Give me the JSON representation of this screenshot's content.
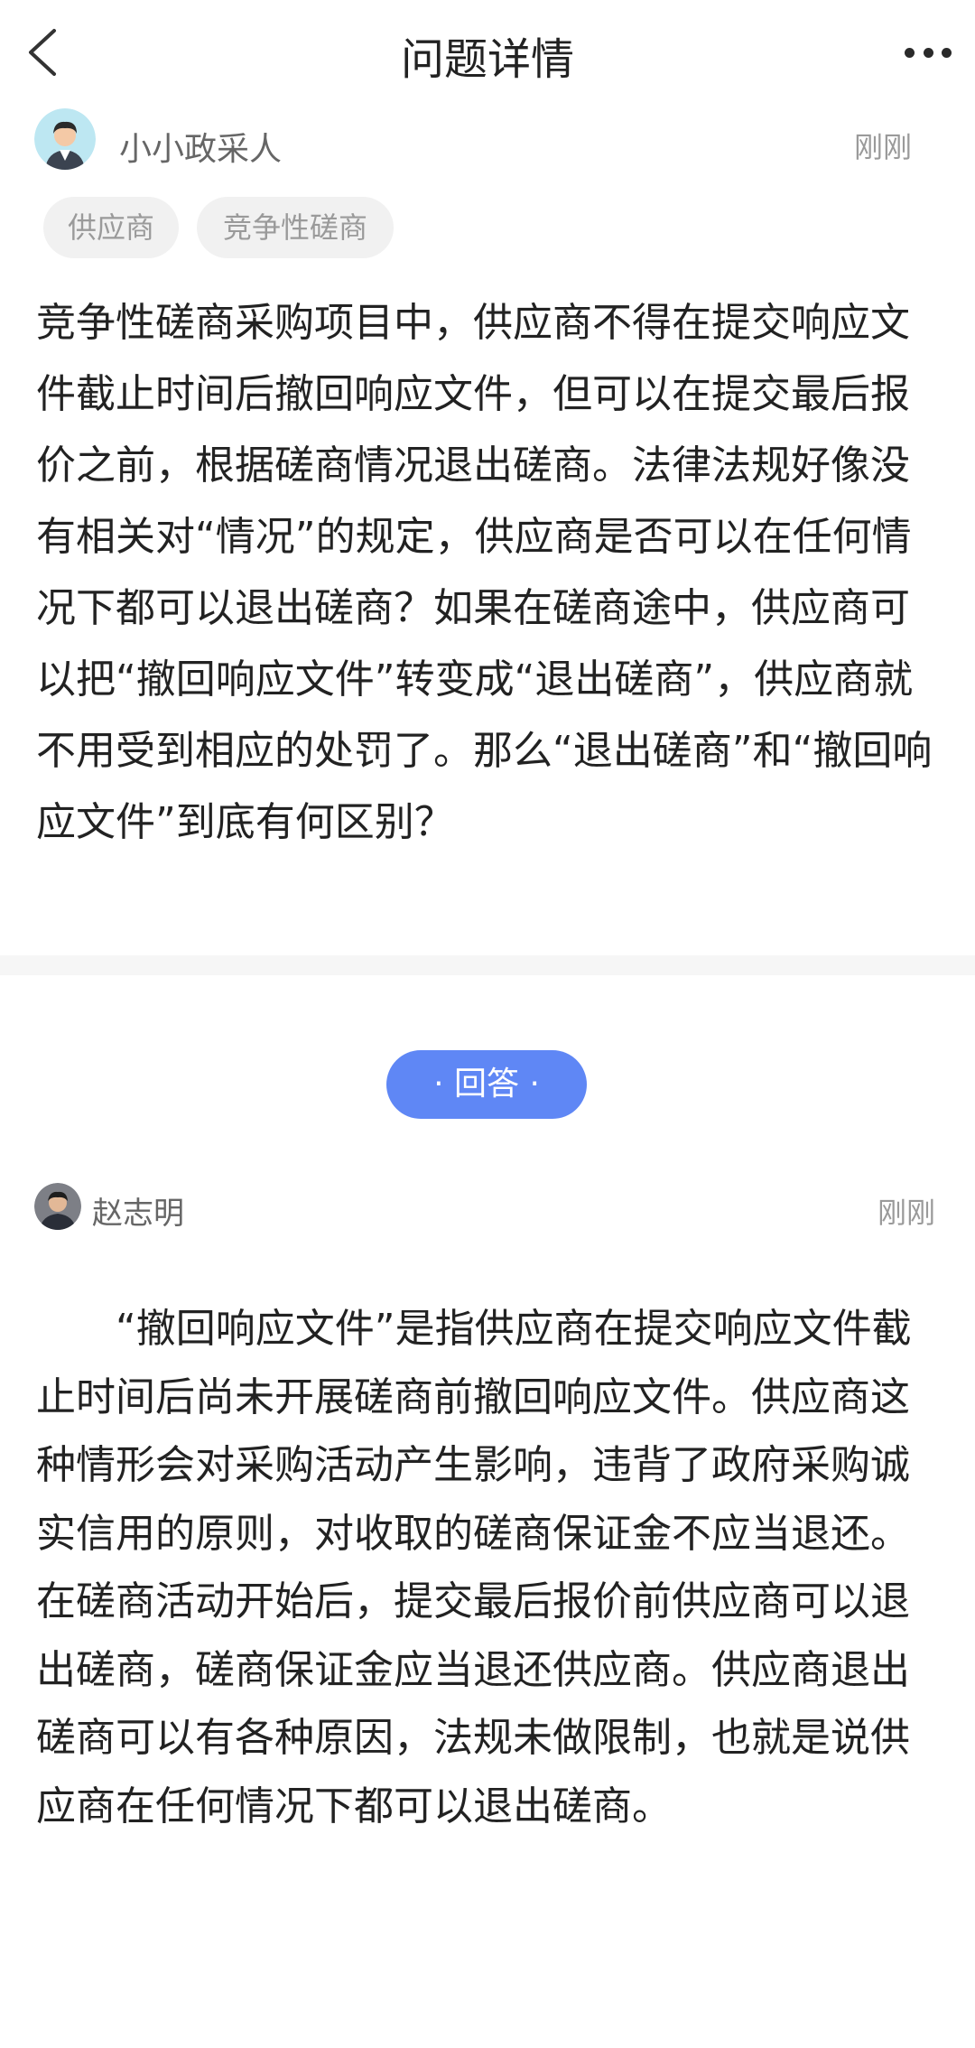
{
  "header": {
    "title": "问题详情",
    "back_icon": "chevron-left-icon",
    "more_icon": "more-dots-icon"
  },
  "question": {
    "author": "小小政采人",
    "time": "刚刚",
    "tags": [
      "供应商",
      "竞争性磋商"
    ],
    "content": "竞争性磋商采购项目中，供应商不得在提交响应文件截止时间后撤回响应文件，但可以在提交最后报价之前，根据磋商情况退出磋商。法律法规好像没有相关对“情况”的规定，供应商是否可以在任何情况下都可以退出磋商？如果在磋商途中，供应商可以把“撤回响应文件”转变成“退出磋商”，供应商就不用受到相应的处罚了。那么“退出磋商”和“撤回响应文件”到底有何区别？"
  },
  "answer_label": "· 回答 ·",
  "answer": {
    "author": "赵志明",
    "time": "刚刚",
    "content": "“撤回响应文件”是指供应商在提交响应文件截止时间后尚未开展磋商前撤回响应文件。供应商这种情形会对采购活动产生影响，违背了政府采购诚实信用的原则，对收取的磋商保证金不应当退还。在磋商活动开始后，提交最后报价前供应商可以退出磋商，磋商保证金应当退还供应商。供应商退出磋商可以有各种原因，法规未做限制，也就是说供应商在任何情况下都可以退出磋商。"
  },
  "colors": {
    "accent": "#5f87f5",
    "tag_bg": "#f1f1f1",
    "muted_text": "#9a9a9a"
  }
}
